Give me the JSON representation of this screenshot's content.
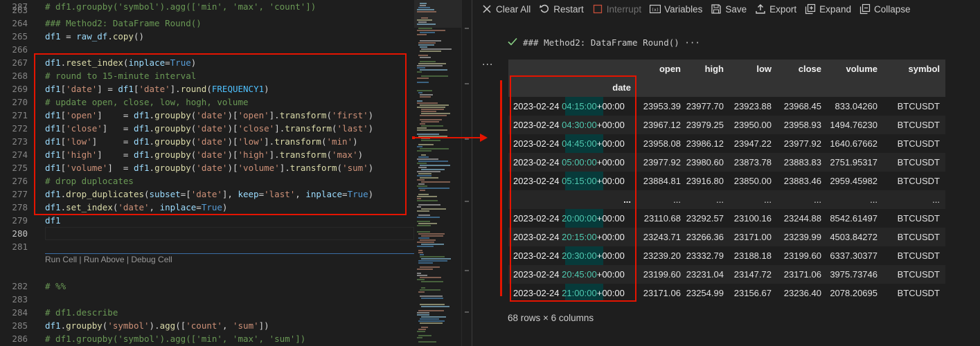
{
  "editor": {
    "lines": [
      {
        "num": "263",
        "tokens": []
      },
      {
        "num": "264",
        "tokens": [
          {
            "t": "cm",
            "v": "### Method2: DataFrame Round()"
          }
        ]
      },
      {
        "num": "265",
        "tokens": [
          {
            "t": "var",
            "v": "df1"
          },
          {
            "t": "pl",
            "v": " = "
          },
          {
            "t": "var",
            "v": "raw_df"
          },
          {
            "t": "pl",
            "v": "."
          },
          {
            "t": "fn",
            "v": "copy"
          },
          {
            "t": "pl",
            "v": "()"
          }
        ]
      },
      {
        "num": "266",
        "tokens": []
      },
      {
        "num": "267",
        "tokens": [
          {
            "t": "var",
            "v": "df1"
          },
          {
            "t": "pl",
            "v": "."
          },
          {
            "t": "fn",
            "v": "reset_index"
          },
          {
            "t": "pl",
            "v": "("
          },
          {
            "t": "var",
            "v": "inplace"
          },
          {
            "t": "pl",
            "v": "="
          },
          {
            "t": "kw",
            "v": "True"
          },
          {
            "t": "pl",
            "v": ")"
          }
        ]
      },
      {
        "num": "268",
        "tokens": [
          {
            "t": "cm",
            "v": "# round to 15-minute interval"
          }
        ]
      },
      {
        "num": "269",
        "tokens": [
          {
            "t": "var",
            "v": "df1"
          },
          {
            "t": "pl",
            "v": "["
          },
          {
            "t": "str",
            "v": "'date'"
          },
          {
            "t": "pl",
            "v": "] = "
          },
          {
            "t": "var",
            "v": "df1"
          },
          {
            "t": "pl",
            "v": "["
          },
          {
            "t": "str",
            "v": "'date'"
          },
          {
            "t": "pl",
            "v": "]."
          },
          {
            "t": "fn",
            "v": "round"
          },
          {
            "t": "pl",
            "v": "("
          },
          {
            "t": "cst",
            "v": "FREQUENCY1"
          },
          {
            "t": "pl",
            "v": ")"
          }
        ]
      },
      {
        "num": "270",
        "tokens": [
          {
            "t": "cm",
            "v": "# update open, close, low, hogh, volume"
          }
        ]
      },
      {
        "num": "271",
        "tokens": [
          {
            "t": "var",
            "v": "df1"
          },
          {
            "t": "pl",
            "v": "["
          },
          {
            "t": "str",
            "v": "'open'"
          },
          {
            "t": "pl",
            "v": "]    = "
          },
          {
            "t": "var",
            "v": "df1"
          },
          {
            "t": "pl",
            "v": "."
          },
          {
            "t": "fn",
            "v": "groupby"
          },
          {
            "t": "pl",
            "v": "("
          },
          {
            "t": "str",
            "v": "'date'"
          },
          {
            "t": "pl",
            "v": ")["
          },
          {
            "t": "str",
            "v": "'open'"
          },
          {
            "t": "pl",
            "v": "]."
          },
          {
            "t": "fn",
            "v": "transform"
          },
          {
            "t": "pl",
            "v": "("
          },
          {
            "t": "str",
            "v": "'first'"
          },
          {
            "t": "pl",
            "v": ")"
          }
        ]
      },
      {
        "num": "272",
        "tokens": [
          {
            "t": "var",
            "v": "df1"
          },
          {
            "t": "pl",
            "v": "["
          },
          {
            "t": "str",
            "v": "'close'"
          },
          {
            "t": "pl",
            "v": "]   = "
          },
          {
            "t": "var",
            "v": "df1"
          },
          {
            "t": "pl",
            "v": "."
          },
          {
            "t": "fn",
            "v": "groupby"
          },
          {
            "t": "pl",
            "v": "("
          },
          {
            "t": "str",
            "v": "'date'"
          },
          {
            "t": "pl",
            "v": ")["
          },
          {
            "t": "str",
            "v": "'close'"
          },
          {
            "t": "pl",
            "v": "]."
          },
          {
            "t": "fn",
            "v": "transform"
          },
          {
            "t": "pl",
            "v": "("
          },
          {
            "t": "str",
            "v": "'last'"
          },
          {
            "t": "pl",
            "v": ")"
          }
        ]
      },
      {
        "num": "273",
        "tokens": [
          {
            "t": "var",
            "v": "df1"
          },
          {
            "t": "pl",
            "v": "["
          },
          {
            "t": "str",
            "v": "'low'"
          },
          {
            "t": "pl",
            "v": "]     = "
          },
          {
            "t": "var",
            "v": "df1"
          },
          {
            "t": "pl",
            "v": "."
          },
          {
            "t": "fn",
            "v": "groupby"
          },
          {
            "t": "pl",
            "v": "("
          },
          {
            "t": "str",
            "v": "'date'"
          },
          {
            "t": "pl",
            "v": ")["
          },
          {
            "t": "str",
            "v": "'low'"
          },
          {
            "t": "pl",
            "v": "]."
          },
          {
            "t": "fn",
            "v": "transform"
          },
          {
            "t": "pl",
            "v": "("
          },
          {
            "t": "str",
            "v": "'min'"
          },
          {
            "t": "pl",
            "v": ")"
          }
        ]
      },
      {
        "num": "274",
        "tokens": [
          {
            "t": "var",
            "v": "df1"
          },
          {
            "t": "pl",
            "v": "["
          },
          {
            "t": "str",
            "v": "'high'"
          },
          {
            "t": "pl",
            "v": "]    = "
          },
          {
            "t": "var",
            "v": "df1"
          },
          {
            "t": "pl",
            "v": "."
          },
          {
            "t": "fn",
            "v": "groupby"
          },
          {
            "t": "pl",
            "v": "("
          },
          {
            "t": "str",
            "v": "'date'"
          },
          {
            "t": "pl",
            "v": ")["
          },
          {
            "t": "str",
            "v": "'high'"
          },
          {
            "t": "pl",
            "v": "]."
          },
          {
            "t": "fn",
            "v": "transform"
          },
          {
            "t": "pl",
            "v": "("
          },
          {
            "t": "str",
            "v": "'max'"
          },
          {
            "t": "pl",
            "v": ")"
          }
        ]
      },
      {
        "num": "275",
        "tokens": [
          {
            "t": "var",
            "v": "df1"
          },
          {
            "t": "pl",
            "v": "["
          },
          {
            "t": "str",
            "v": "'volume'"
          },
          {
            "t": "pl",
            "v": "]  = "
          },
          {
            "t": "var",
            "v": "df1"
          },
          {
            "t": "pl",
            "v": "."
          },
          {
            "t": "fn",
            "v": "groupby"
          },
          {
            "t": "pl",
            "v": "("
          },
          {
            "t": "str",
            "v": "'date'"
          },
          {
            "t": "pl",
            "v": ")["
          },
          {
            "t": "str",
            "v": "'volume'"
          },
          {
            "t": "pl",
            "v": "]."
          },
          {
            "t": "fn",
            "v": "transform"
          },
          {
            "t": "pl",
            "v": "("
          },
          {
            "t": "str",
            "v": "'sum'"
          },
          {
            "t": "pl",
            "v": ")"
          }
        ]
      },
      {
        "num": "276",
        "tokens": [
          {
            "t": "cm",
            "v": "# drop duplocates"
          }
        ]
      },
      {
        "num": "277",
        "tokens": [
          {
            "t": "var",
            "v": "df1"
          },
          {
            "t": "pl",
            "v": "."
          },
          {
            "t": "fn",
            "v": "drop_duplicates"
          },
          {
            "t": "pl",
            "v": "("
          },
          {
            "t": "var",
            "v": "subset"
          },
          {
            "t": "pl",
            "v": "=["
          },
          {
            "t": "str",
            "v": "'date'"
          },
          {
            "t": "pl",
            "v": "], "
          },
          {
            "t": "var",
            "v": "keep"
          },
          {
            "t": "pl",
            "v": "="
          },
          {
            "t": "str",
            "v": "'last'"
          },
          {
            "t": "pl",
            "v": ", "
          },
          {
            "t": "var",
            "v": "inplace"
          },
          {
            "t": "pl",
            "v": "="
          },
          {
            "t": "kw",
            "v": "True"
          },
          {
            "t": "pl",
            "v": ")"
          }
        ]
      },
      {
        "num": "278",
        "tokens": [
          {
            "t": "var",
            "v": "df1"
          },
          {
            "t": "pl",
            "v": "."
          },
          {
            "t": "fn",
            "v": "set_index"
          },
          {
            "t": "pl",
            "v": "("
          },
          {
            "t": "str",
            "v": "'date'"
          },
          {
            "t": "pl",
            "v": ", "
          },
          {
            "t": "var",
            "v": "inplace"
          },
          {
            "t": "pl",
            "v": "="
          },
          {
            "t": "kw",
            "v": "True"
          },
          {
            "t": "pl",
            "v": ")"
          }
        ]
      },
      {
        "num": "279",
        "tokens": [
          {
            "t": "var",
            "v": "df1"
          }
        ]
      },
      {
        "num": "280",
        "tokens": [],
        "active": true
      },
      {
        "num": "281",
        "tokens": []
      },
      {
        "num": "282",
        "tokens": [
          {
            "t": "cm",
            "v": "# %%"
          }
        ]
      },
      {
        "num": "283",
        "tokens": []
      },
      {
        "num": "284",
        "tokens": [
          {
            "t": "cm",
            "v": "# df1.describe"
          }
        ]
      },
      {
        "num": "285",
        "tokens": [
          {
            "t": "var",
            "v": "df1"
          },
          {
            "t": "pl",
            "v": "."
          },
          {
            "t": "fn",
            "v": "groupby"
          },
          {
            "t": "pl",
            "v": "("
          },
          {
            "t": "str",
            "v": "'symbol'"
          },
          {
            "t": "pl",
            "v": ")."
          },
          {
            "t": "fn",
            "v": "agg"
          },
          {
            "t": "pl",
            "v": "(["
          },
          {
            "t": "str",
            "v": "'count'"
          },
          {
            "t": "pl",
            "v": ", "
          },
          {
            "t": "str",
            "v": "'sum'"
          },
          {
            "t": "pl",
            "v": "])"
          }
        ]
      },
      {
        "num": "286",
        "tokens": [
          {
            "t": "cm",
            "v": "# df1.groupby('symbol').agg(['min', 'max', 'sum'])"
          }
        ]
      },
      {
        "num": "287",
        "tokens": [
          {
            "t": "cm",
            "v": "# df1.groupby('symbol').agg(['min', 'max', 'count'])"
          }
        ]
      }
    ],
    "codelens": {
      "run_cell": "Run Cell",
      "sep1": " | ",
      "run_above": "Run Above",
      "sep2": " | ",
      "debug_cell": "Debug Cell"
    }
  },
  "toolbar": {
    "clear_all": "Clear All",
    "restart": "Restart",
    "interrupt": "Interrupt",
    "variables": "Variables",
    "save": "Save",
    "export": "Export",
    "expand": "Expand",
    "collapse": "Collapse"
  },
  "cell": {
    "title": "### Method2: DataFrame Round()",
    "more": "···"
  },
  "output": {
    "more": "···",
    "table": {
      "columns": [
        "open",
        "high",
        "low",
        "close",
        "volume",
        "symbol"
      ],
      "index_name": "date",
      "rows": [
        {
          "d1": "2023-02-24",
          "t": "04:15:00",
          "d2": "+00:00",
          "vals": [
            "23953.39",
            "23977.70",
            "23923.88",
            "23968.45",
            "833.04260",
            "BTCUSDT"
          ]
        },
        {
          "d1": "2023-02-24",
          "t": "04:30:00",
          "d2": "+00:00",
          "vals": [
            "23967.12",
            "23979.25",
            "23950.00",
            "23958.93",
            "1494.76230",
            "BTCUSDT"
          ]
        },
        {
          "d1": "2023-02-24",
          "t": "04:45:00",
          "d2": "+00:00",
          "vals": [
            "23958.08",
            "23986.12",
            "23947.22",
            "23977.92",
            "1640.67662",
            "BTCUSDT"
          ]
        },
        {
          "d1": "2023-02-24",
          "t": "05:00:00",
          "d2": "+00:00",
          "vals": [
            "23977.92",
            "23980.60",
            "23873.78",
            "23883.83",
            "2751.95317",
            "BTCUSDT"
          ]
        },
        {
          "d1": "2023-02-24",
          "t": "05:15:00",
          "d2": "+00:00",
          "vals": [
            "23884.81",
            "23916.80",
            "23850.00",
            "23883.46",
            "2959.45982",
            "BTCUSDT"
          ]
        },
        {
          "ellipsis": true,
          "idx": "...",
          "vals": [
            "...",
            "...",
            "...",
            "...",
            "...",
            "..."
          ]
        },
        {
          "d1": "2023-02-24",
          "t": "20:00:00",
          "d2": "+00:00",
          "vals": [
            "23110.68",
            "23292.57",
            "23100.16",
            "23244.88",
            "8542.61497",
            "BTCUSDT"
          ]
        },
        {
          "d1": "2023-02-24",
          "t": "20:15:00",
          "d2": "+00:00",
          "vals": [
            "23243.71",
            "23266.36",
            "23171.00",
            "23239.99",
            "4503.84272",
            "BTCUSDT"
          ]
        },
        {
          "d1": "2023-02-24",
          "t": "20:30:00",
          "d2": "+00:00",
          "vals": [
            "23239.20",
            "23332.79",
            "23188.18",
            "23199.60",
            "6337.30377",
            "BTCUSDT"
          ]
        },
        {
          "d1": "2023-02-24",
          "t": "20:45:00",
          "d2": "+00:00",
          "vals": [
            "23199.60",
            "23231.04",
            "23147.72",
            "23171.06",
            "3975.73746",
            "BTCUSDT"
          ]
        },
        {
          "d1": "2023-02-24",
          "t": "21:00:00",
          "d2": "+00:00",
          "vals": [
            "23171.06",
            "23254.99",
            "23156.67",
            "23236.40",
            "2078.20695",
            "BTCUSDT"
          ]
        }
      ],
      "footer": "68 rows × 6 columns"
    }
  },
  "colors": {
    "highlight_box": "#e51400",
    "teal_text": "#4ec9b0",
    "teal_bg": "#073a3a",
    "success": "#89d185"
  }
}
